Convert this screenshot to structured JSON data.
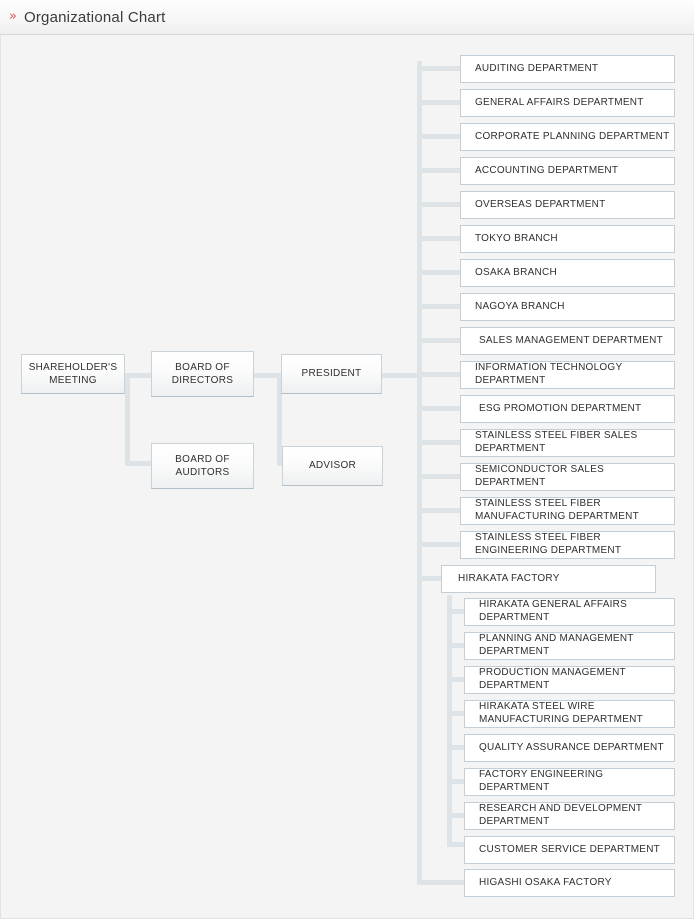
{
  "header": {
    "icon": "double-chevron-right-icon",
    "title": "Organizational Chart"
  },
  "colors": {
    "accent": "#e0565f",
    "connector": "#dde3e7",
    "box_border": "#c3ced6",
    "canvas_bg": "#f4f4f4",
    "text": "#2f2f2f"
  },
  "executive": [
    {
      "id": "shareholders-meeting",
      "label": "SHAREHOLDER'S MEETING"
    },
    {
      "id": "board-of-directors",
      "label": "BOARD OF DIRECTORS"
    },
    {
      "id": "board-of-auditors",
      "label": "BOARD OF AUDITORS"
    },
    {
      "id": "president",
      "label": "PRESIDENT"
    },
    {
      "id": "advisor",
      "label": "ADVISOR"
    }
  ],
  "departments": [
    {
      "id": "auditing",
      "label": "AUDITING DEPARTMENT"
    },
    {
      "id": "general-affairs",
      "label": "GENERAL AFFAIRS DEPARTMENT"
    },
    {
      "id": "corporate-planning",
      "label": "CORPORATE PLANNING DEPARTMENT"
    },
    {
      "id": "accounting",
      "label": "ACCOUNTING DEPARTMENT"
    },
    {
      "id": "overseas",
      "label": "OVERSEAS DEPARTMENT"
    },
    {
      "id": "tokyo-branch",
      "label": "TOKYO BRANCH"
    },
    {
      "id": "osaka-branch",
      "label": "OSAKA BRANCH"
    },
    {
      "id": "nagoya-branch",
      "label": "NAGOYA BRANCH"
    },
    {
      "id": "sales-management",
      "label": "SALES MANAGEMENT DEPARTMENT"
    },
    {
      "id": "information-technology",
      "label": "INFORMATION TECHNOLOGY DEPARTMENT"
    },
    {
      "id": "esg-promotion",
      "label": "ESG PROMOTION DEPARTMENT"
    },
    {
      "id": "stainless-steel-fiber-sales",
      "label": "STAINLESS STEEL FIBER SALES DEPARTMENT"
    },
    {
      "id": "semiconductor-sales",
      "label": "SEMICONDUCTOR SALES DEPARTMENT"
    },
    {
      "id": "stainless-steel-fiber-manufacturing",
      "label": "STAINLESS STEEL FIBER MANUFACTURING DEPARTMENT"
    },
    {
      "id": "stainless-steel-fiber-engineering",
      "label": "STAINLESS STEEL FIBER ENGINEERING DEPARTMENT"
    }
  ],
  "hirakata_factory": {
    "id": "hirakata-factory",
    "label": "HIRAKATA FACTORY",
    "children": [
      {
        "id": "hirakata-general-affairs",
        "label": "HIRAKATA GENERAL AFFAIRS DEPARTMENT"
      },
      {
        "id": "planning-and-management",
        "label": "PLANNING AND MANAGEMENT DEPARTMENT"
      },
      {
        "id": "production-management",
        "label": "PRODUCTION MANAGEMENT DEPARTMENT"
      },
      {
        "id": "hirakata-steel-wire-manufacturing",
        "label": "HIRAKATA STEEL WIRE MANUFACTURING DEPARTMENT"
      },
      {
        "id": "quality-assurance",
        "label": "QUALITY ASSURANCE DEPARTMENT"
      },
      {
        "id": "factory-engineering",
        "label": "FACTORY ENGINEERING DEPARTMENT"
      },
      {
        "id": "research-and-development",
        "label": "RESEARCH AND DEVELOPMENT DEPARTMENT"
      },
      {
        "id": "customer-service",
        "label": "CUSTOMER SERVICE DEPARTMENT"
      }
    ]
  },
  "higashi_osaka_factory": {
    "id": "higashi-osaka-factory",
    "label": "HIGASHI OSAKA FACTORY"
  }
}
